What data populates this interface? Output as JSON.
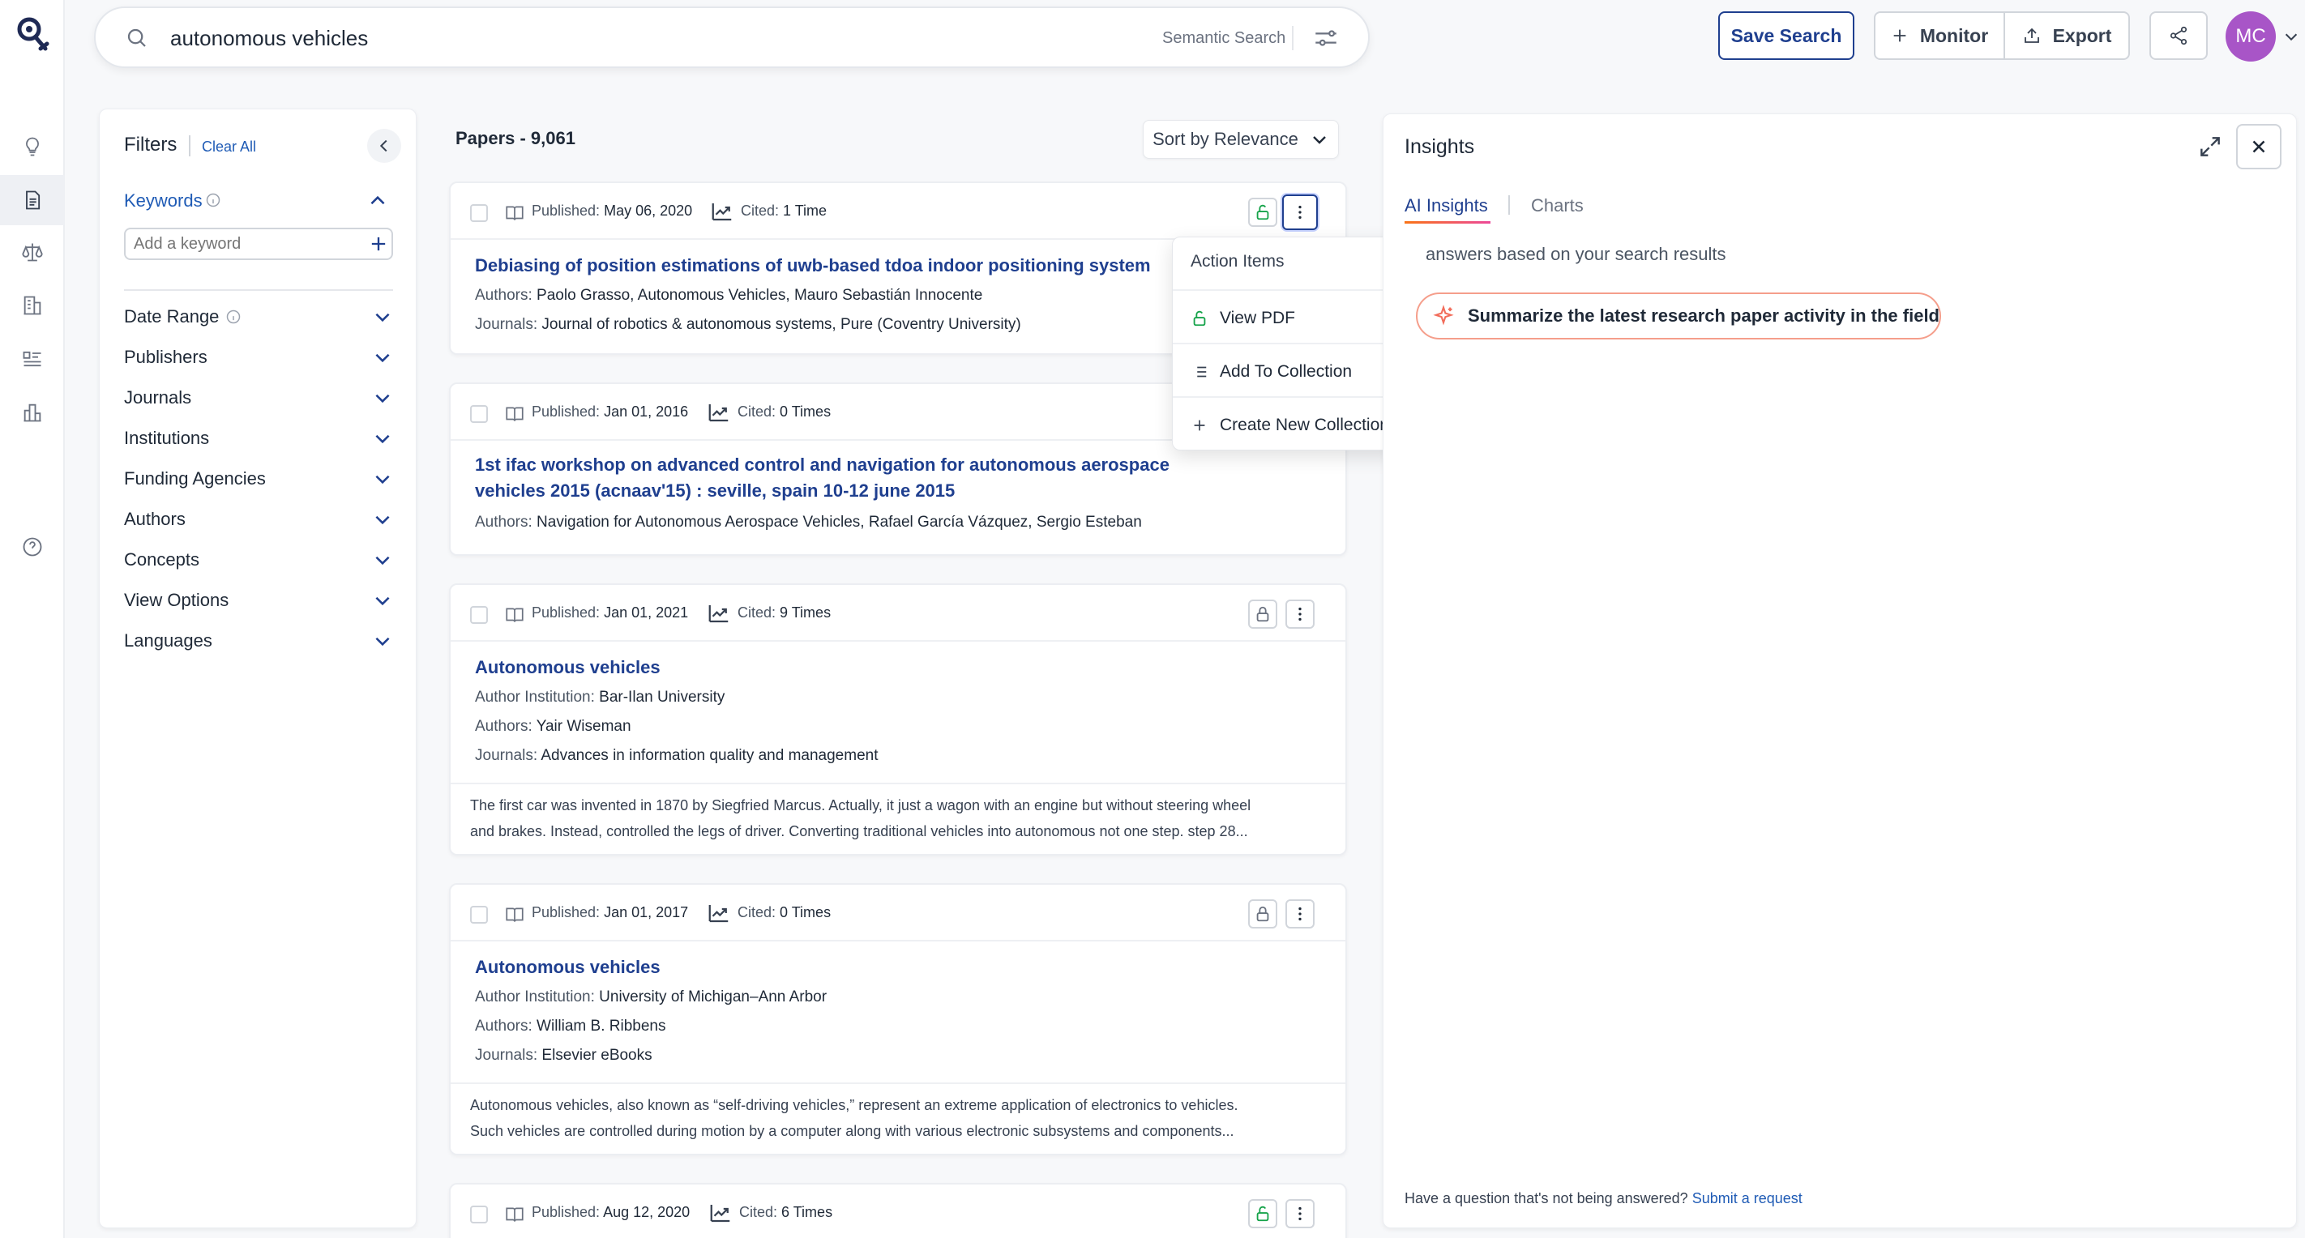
{
  "colors": {
    "brand": "#1f3f8f",
    "link": "#1f5bb5",
    "avatar": "#a855c7",
    "accent_pill": "#f59e8b"
  },
  "rail": {
    "logo": "search-logo-icon",
    "icons": [
      "lightbulb-icon",
      "document-icon",
      "scales-icon",
      "building-icon",
      "list-details-icon",
      "bar-chart-icon",
      "help-circle-icon"
    ]
  },
  "search": {
    "query": "autonomous vehicles",
    "mode_label": "Semantic Search"
  },
  "header": {
    "save_label": "Save Search",
    "monitor_label": "Monitor",
    "export_label": "Export",
    "avatar_initials": "MC"
  },
  "filters": {
    "title": "Filters",
    "clear_all": "Clear All",
    "keywords_label": "Keywords",
    "keyword_placeholder": "Add a keyword",
    "groups": [
      "Date Range",
      "Publishers",
      "Journals",
      "Institutions",
      "Funding Agencies",
      "Authors",
      "Concepts",
      "View Options",
      "Languages"
    ]
  },
  "results": {
    "count_label": "Papers - 9,061",
    "sort_label": "Sort by Relevance",
    "published_prefix": "Published:",
    "cited_prefix": "Cited:",
    "papers": [
      {
        "published": "May 06, 2020",
        "cited": "1 Time",
        "title_lines": [
          "Debiasing of position estimations of uwb-based tdoa indoor positioning system"
        ],
        "lines": [
          {
            "label": "Authors:",
            "value": "Paolo Grasso, Autonomous Vehicles, Mauro Sebastián Innocente"
          },
          {
            "label": "Journals:",
            "value": "Journal of robotics & autonomous systems, Pure (Coventry University)"
          }
        ],
        "abstract": []
      },
      {
        "published": "Jan 01, 2016",
        "cited": "0 Times",
        "title_lines": [
          "1st ifac workshop on advanced control and navigation for autonomous aerospace",
          "vehicles 2015 (acnaav'15) : seville, spain 10-12 june 2015"
        ],
        "lines": [
          {
            "label": "Authors:",
            "value": "Navigation for Autonomous Aerospace Vehicles, Rafael García Vázquez, Sergio Esteban"
          }
        ],
        "abstract": []
      },
      {
        "published": "Jan 01, 2021",
        "cited": "9 Times",
        "title_lines": [
          "Autonomous vehicles"
        ],
        "lines": [
          {
            "label": "Author Institution:",
            "value": "Bar-Ilan University"
          },
          {
            "label": "Authors:",
            "value": "Yair Wiseman"
          },
          {
            "label": "Journals:",
            "value": "Advances in information quality and management"
          }
        ],
        "abstract": [
          "The first car was invented in 1870 by Siegfried Marcus. Actually, it just a wagon with an engine but without steering wheel",
          "and brakes. Instead, controlled the legs of driver. Converting traditional vehicles into autonomous not one step. step 28..."
        ]
      },
      {
        "published": "Jan 01, 2017",
        "cited": "0 Times",
        "title_lines": [
          "Autonomous vehicles"
        ],
        "lines": [
          {
            "label": "Author Institution:",
            "value": "University of Michigan–Ann Arbor"
          },
          {
            "label": "Authors:",
            "value": "William B. Ribbens"
          },
          {
            "label": "Journals:",
            "value": "Elsevier eBooks"
          }
        ],
        "abstract": [
          "Autonomous vehicles, also known as “self-driving vehicles,” represent an extreme application of electronics to vehicles.",
          "Such vehicles are controlled during motion by a computer along with various electronic subsystems and components..."
        ]
      },
      {
        "published": "Aug 12, 2020",
        "cited": "6 Times",
        "title_lines": [],
        "lines": [],
        "abstract": []
      }
    ]
  },
  "action_menu": {
    "header": "Action Items",
    "items": [
      "View PDF",
      "Add To Collection",
      "Create New Collection"
    ]
  },
  "insights": {
    "title": "Insights",
    "tab_ai": "AI Insights",
    "tab_charts": "Charts",
    "description": "answers based on your search results",
    "suggestion": "Summarize the latest research paper activity in the field",
    "footer_text": "Have a question that's not being answered?",
    "footer_link": "Submit a request"
  }
}
